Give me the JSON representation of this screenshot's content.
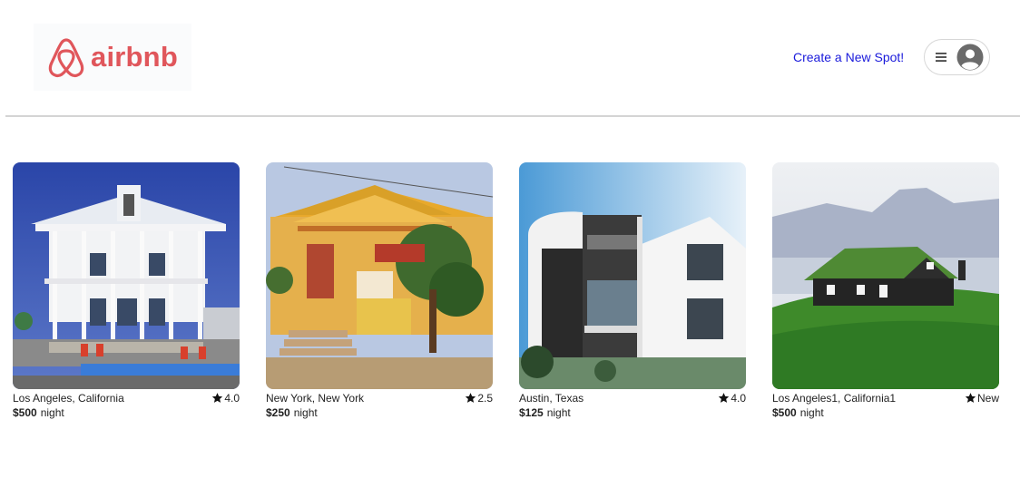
{
  "header": {
    "logo_text": "airbnb",
    "create_spot_label": "Create a New Spot!",
    "brand_color": "#e0565b"
  },
  "spots": [
    {
      "location": "Los Angeles, California",
      "rating": "4.0",
      "price": "$500",
      "unit": "night",
      "image": "white-beach-house"
    },
    {
      "location": "New York, New York",
      "rating": "2.5",
      "price": "$250",
      "unit": "night",
      "image": "yellow-bungalow"
    },
    {
      "location": "Austin, Texas",
      "rating": "4.0",
      "price": "$125",
      "unit": "night",
      "image": "modern-building"
    },
    {
      "location": "Los Angeles1, California1",
      "rating": "New",
      "price": "$500",
      "unit": "night",
      "image": "grass-roof-cabin"
    }
  ]
}
